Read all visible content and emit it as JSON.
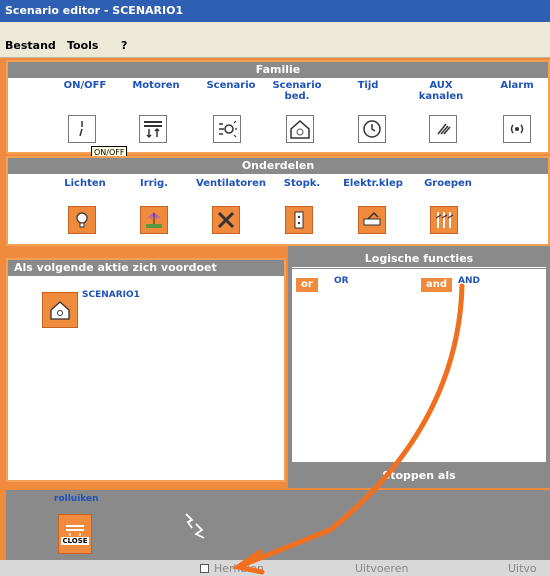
{
  "window": {
    "title": "Scenario editor - SCENARIO1"
  },
  "menu": {
    "items": [
      "Bestand",
      "Tools",
      "?"
    ]
  },
  "familie": {
    "title": "Familie",
    "items": [
      {
        "label": "ON/OFF",
        "icon": "switch-icon"
      },
      {
        "label": "Motoren",
        "icon": "motor-icon"
      },
      {
        "label": "Scenario",
        "icon": "scenario-icon"
      },
      {
        "label": "Scenario bed.",
        "icon": "scenario-control-icon"
      },
      {
        "label": "Tijd",
        "icon": "clock-icon"
      },
      {
        "label": "AUX kanalen",
        "icon": "aux-icon"
      },
      {
        "label": "Alarm",
        "icon": "alarm-icon"
      }
    ],
    "tooltip": "ON/OFF"
  },
  "onderdelen": {
    "title": "Onderdelen",
    "items": [
      {
        "label": "Lichten",
        "icon": "bulb-icon"
      },
      {
        "label": "Irrig.",
        "icon": "irrigation-icon"
      },
      {
        "label": "Ventilatoren",
        "icon": "fan-icon"
      },
      {
        "label": "Stopk.",
        "icon": "socket-icon"
      },
      {
        "label": "Elektr.klep",
        "icon": "valve-icon"
      },
      {
        "label": "Groepen",
        "icon": "groups-icon"
      }
    ]
  },
  "trigger": {
    "title": "Als volgende aktie zich voordoet",
    "item": "SCENARIO1"
  },
  "logic": {
    "title": "Logische functies",
    "or_badge": "or",
    "or_label": "OR",
    "and_badge": "and",
    "and_label": "AND",
    "stop_title": "Stoppen als"
  },
  "actions": {
    "item_label": "rolluiken",
    "close_label": "CLOSE"
  },
  "footer": {
    "repeat": "Herhalen",
    "execute": "Uitvoeren",
    "execute_cut": "Uitvo"
  },
  "colors": {
    "accent": "#f08a3c",
    "title": "#2f5fb3",
    "label": "#1f52b8",
    "header": "#8a8a8a"
  }
}
